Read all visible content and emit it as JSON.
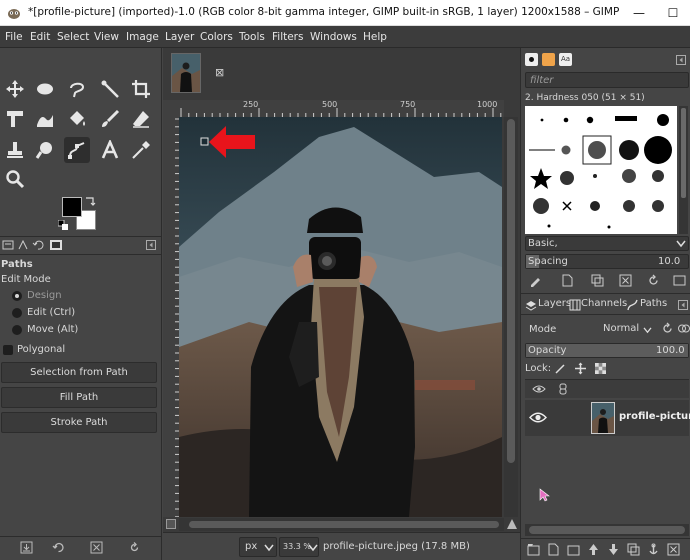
{
  "window": {
    "title": "*[profile-picture] (imported)-1.0 (RGB color 8-bit gamma integer, GIMP built-in sRGB, 1 layer) 1200x1588 – GIMP",
    "minimize": "—",
    "maximize": "☐"
  },
  "menu": [
    "File",
    "Edit",
    "Select",
    "View",
    "Image",
    "Layer",
    "Colors",
    "Tools",
    "Filters",
    "Windows",
    "Help"
  ],
  "image_tab": {
    "close": "⊠"
  },
  "ruler": {
    "marks": [
      "250",
      "500",
      "750",
      "1000"
    ]
  },
  "tool_options": {
    "title": "Paths",
    "edit_mode_label": "Edit Mode",
    "modes": [
      "Design",
      "Edit (Ctrl)",
      "Move (Alt)"
    ],
    "selected_mode": 0,
    "polygonal_label": "Polygonal",
    "buttons": [
      "Selection from Path",
      "Fill Path",
      "Stroke Path"
    ]
  },
  "brushes": {
    "filter_placeholder": "filter",
    "current": "2. Hardness 050 (51 × 51)",
    "preset": "Basic,",
    "spacing_label": "Spacing",
    "spacing_value": "10.0"
  },
  "layers_panel": {
    "tabs": [
      "Layers",
      "Channels",
      "Paths"
    ],
    "mode_label": "Mode",
    "mode_value": "Normal",
    "opacity_label": "Opacity",
    "opacity_value": "100.0",
    "lock_label": "Lock:",
    "layer_name": "profile-picture"
  },
  "status": {
    "unit": "px",
    "zoom": "33.3 %",
    "file_info": "profile-picture.jpeg (17.8 MB)"
  },
  "colors": {
    "fg": "#000000",
    "bg": "#ffffff",
    "arrow": "#e8141b",
    "accent": "#f0a44a"
  }
}
